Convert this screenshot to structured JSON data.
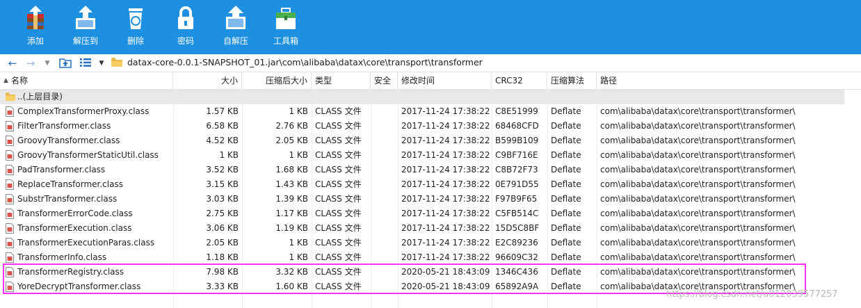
{
  "toolbar": {
    "buttons": [
      {
        "label": "添加",
        "icon": "add-archive-icon"
      },
      {
        "label": "解压到",
        "icon": "extract-to-icon"
      },
      {
        "label": "删除",
        "icon": "recycle-bin-icon"
      },
      {
        "label": "密码",
        "icon": "padlock-icon"
      },
      {
        "label": "自解压",
        "icon": "self-extract-icon"
      },
      {
        "label": "工具箱",
        "icon": "toolbox-icon"
      }
    ]
  },
  "address": {
    "path": "datax-core-0.0.1-SNAPSHOT_01.jar\\com\\alibaba\\datax\\core\\transport\\transformer"
  },
  "columns": {
    "name": "名称",
    "size": "大小",
    "packed": "压缩后大小",
    "type": "类型",
    "security": "安全",
    "modified": "修改时间",
    "crc": "CRC32",
    "method": "压缩算法",
    "path": "路径"
  },
  "parent_row": {
    "name": "..(上层目录)"
  },
  "files": [
    {
      "name": "ComplexTransformerProxy.class",
      "size": "1.57 KB",
      "packed": "1 KB",
      "type": "CLASS 文件",
      "modified": "2017-11-24 17:38:22",
      "crc": "C8E51999",
      "method": "Deflate",
      "path": "com\\alibaba\\datax\\core\\transport\\transformer\\"
    },
    {
      "name": "FilterTransformer.class",
      "size": "6.58 KB",
      "packed": "2.76 KB",
      "type": "CLASS 文件",
      "modified": "2017-11-24 17:38:22",
      "crc": "68468CFD",
      "method": "Deflate",
      "path": "com\\alibaba\\datax\\core\\transport\\transformer\\"
    },
    {
      "name": "GroovyTransformer.class",
      "size": "4.52 KB",
      "packed": "2.05 KB",
      "type": "CLASS 文件",
      "modified": "2017-11-24 17:38:22",
      "crc": "B599B109",
      "method": "Deflate",
      "path": "com\\alibaba\\datax\\core\\transport\\transformer\\"
    },
    {
      "name": "GroovyTransformerStaticUtil.class",
      "size": "1 KB",
      "packed": "1 KB",
      "type": "CLASS 文件",
      "modified": "2017-11-24 17:38:22",
      "crc": "C9BF716E",
      "method": "Deflate",
      "path": "com\\alibaba\\datax\\core\\transport\\transformer\\"
    },
    {
      "name": "PadTransformer.class",
      "size": "3.52 KB",
      "packed": "1.68 KB",
      "type": "CLASS 文件",
      "modified": "2017-11-24 17:38:22",
      "crc": "C8B72F73",
      "method": "Deflate",
      "path": "com\\alibaba\\datax\\core\\transport\\transformer\\"
    },
    {
      "name": "ReplaceTransformer.class",
      "size": "3.15 KB",
      "packed": "1.43 KB",
      "type": "CLASS 文件",
      "modified": "2017-11-24 17:38:22",
      "crc": "0E791D55",
      "method": "Deflate",
      "path": "com\\alibaba\\datax\\core\\transport\\transformer\\"
    },
    {
      "name": "SubstrTransformer.class",
      "size": "3.03 KB",
      "packed": "1.39 KB",
      "type": "CLASS 文件",
      "modified": "2017-11-24 17:38:22",
      "crc": "F97B9F65",
      "method": "Deflate",
      "path": "com\\alibaba\\datax\\core\\transport\\transformer\\"
    },
    {
      "name": "TransformerErrorCode.class",
      "size": "2.75 KB",
      "packed": "1.17 KB",
      "type": "CLASS 文件",
      "modified": "2017-11-24 17:38:22",
      "crc": "C5FB514C",
      "method": "Deflate",
      "path": "com\\alibaba\\datax\\core\\transport\\transformer\\"
    },
    {
      "name": "TransformerExecution.class",
      "size": "3.06 KB",
      "packed": "1.19 KB",
      "type": "CLASS 文件",
      "modified": "2017-11-24 17:38:22",
      "crc": "15D5C8BF",
      "method": "Deflate",
      "path": "com\\alibaba\\datax\\core\\transport\\transformer\\"
    },
    {
      "name": "TransformerExecutionParas.class",
      "size": "2.05 KB",
      "packed": "1 KB",
      "type": "CLASS 文件",
      "modified": "2017-11-24 17:38:22",
      "crc": "E2C89236",
      "method": "Deflate",
      "path": "com\\alibaba\\datax\\core\\transport\\transformer\\"
    },
    {
      "name": "TransformerInfo.class",
      "size": "1.18 KB",
      "packed": "1 KB",
      "type": "CLASS 文件",
      "modified": "2017-11-24 17:38:22",
      "crc": "96609C32",
      "method": "Deflate",
      "path": "com\\alibaba\\datax\\core\\transport\\transformer\\"
    },
    {
      "name": "TransformerRegistry.class",
      "size": "7.98 KB",
      "packed": "3.32 KB",
      "type": "CLASS 文件",
      "modified": "2020-05-21 18:43:09",
      "crc": "1346C436",
      "method": "Deflate",
      "path": "com\\alibaba\\datax\\core\\transport\\transformer\\"
    },
    {
      "name": "YoreDecryptTransformer.class",
      "size": "3.33 KB",
      "packed": "1.60 KB",
      "type": "CLASS 文件",
      "modified": "2020-05-21 18:43:09",
      "crc": "65892A9A",
      "method": "Deflate",
      "path": "com\\alibaba\\datax\\core\\transport\\transformer\\"
    }
  ],
  "watermark": "https://blog.csdn.net/u012039577257",
  "colors": {
    "toolbar": "#1e90e2",
    "highlight": "#ff30ff"
  }
}
